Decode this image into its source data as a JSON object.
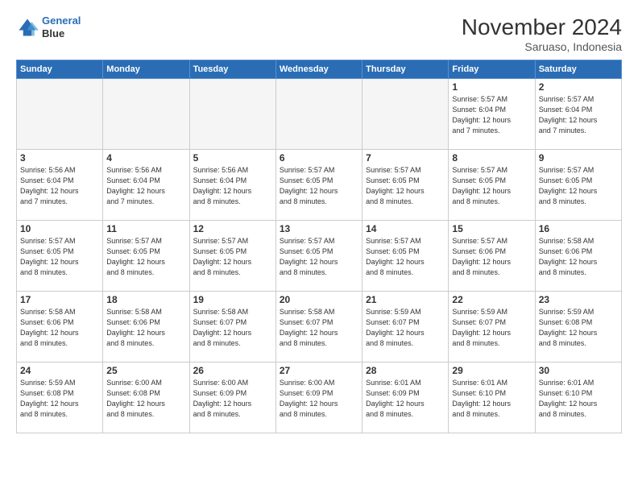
{
  "header": {
    "logo_line1": "General",
    "logo_line2": "Blue",
    "month": "November 2024",
    "location": "Saruaso, Indonesia"
  },
  "weekdays": [
    "Sunday",
    "Monday",
    "Tuesday",
    "Wednesday",
    "Thursday",
    "Friday",
    "Saturday"
  ],
  "weeks": [
    [
      {
        "day": "",
        "info": ""
      },
      {
        "day": "",
        "info": ""
      },
      {
        "day": "",
        "info": ""
      },
      {
        "day": "",
        "info": ""
      },
      {
        "day": "",
        "info": ""
      },
      {
        "day": "1",
        "info": "Sunrise: 5:57 AM\nSunset: 6:04 PM\nDaylight: 12 hours\nand 7 minutes."
      },
      {
        "day": "2",
        "info": "Sunrise: 5:57 AM\nSunset: 6:04 PM\nDaylight: 12 hours\nand 7 minutes."
      }
    ],
    [
      {
        "day": "3",
        "info": "Sunrise: 5:56 AM\nSunset: 6:04 PM\nDaylight: 12 hours\nand 7 minutes."
      },
      {
        "day": "4",
        "info": "Sunrise: 5:56 AM\nSunset: 6:04 PM\nDaylight: 12 hours\nand 7 minutes."
      },
      {
        "day": "5",
        "info": "Sunrise: 5:56 AM\nSunset: 6:04 PM\nDaylight: 12 hours\nand 8 minutes."
      },
      {
        "day": "6",
        "info": "Sunrise: 5:57 AM\nSunset: 6:05 PM\nDaylight: 12 hours\nand 8 minutes."
      },
      {
        "day": "7",
        "info": "Sunrise: 5:57 AM\nSunset: 6:05 PM\nDaylight: 12 hours\nand 8 minutes."
      },
      {
        "day": "8",
        "info": "Sunrise: 5:57 AM\nSunset: 6:05 PM\nDaylight: 12 hours\nand 8 minutes."
      },
      {
        "day": "9",
        "info": "Sunrise: 5:57 AM\nSunset: 6:05 PM\nDaylight: 12 hours\nand 8 minutes."
      }
    ],
    [
      {
        "day": "10",
        "info": "Sunrise: 5:57 AM\nSunset: 6:05 PM\nDaylight: 12 hours\nand 8 minutes."
      },
      {
        "day": "11",
        "info": "Sunrise: 5:57 AM\nSunset: 6:05 PM\nDaylight: 12 hours\nand 8 minutes."
      },
      {
        "day": "12",
        "info": "Sunrise: 5:57 AM\nSunset: 6:05 PM\nDaylight: 12 hours\nand 8 minutes."
      },
      {
        "day": "13",
        "info": "Sunrise: 5:57 AM\nSunset: 6:05 PM\nDaylight: 12 hours\nand 8 minutes."
      },
      {
        "day": "14",
        "info": "Sunrise: 5:57 AM\nSunset: 6:05 PM\nDaylight: 12 hours\nand 8 minutes."
      },
      {
        "day": "15",
        "info": "Sunrise: 5:57 AM\nSunset: 6:06 PM\nDaylight: 12 hours\nand 8 minutes."
      },
      {
        "day": "16",
        "info": "Sunrise: 5:58 AM\nSunset: 6:06 PM\nDaylight: 12 hours\nand 8 minutes."
      }
    ],
    [
      {
        "day": "17",
        "info": "Sunrise: 5:58 AM\nSunset: 6:06 PM\nDaylight: 12 hours\nand 8 minutes."
      },
      {
        "day": "18",
        "info": "Sunrise: 5:58 AM\nSunset: 6:06 PM\nDaylight: 12 hours\nand 8 minutes."
      },
      {
        "day": "19",
        "info": "Sunrise: 5:58 AM\nSunset: 6:07 PM\nDaylight: 12 hours\nand 8 minutes."
      },
      {
        "day": "20",
        "info": "Sunrise: 5:58 AM\nSunset: 6:07 PM\nDaylight: 12 hours\nand 8 minutes."
      },
      {
        "day": "21",
        "info": "Sunrise: 5:59 AM\nSunset: 6:07 PM\nDaylight: 12 hours\nand 8 minutes."
      },
      {
        "day": "22",
        "info": "Sunrise: 5:59 AM\nSunset: 6:07 PM\nDaylight: 12 hours\nand 8 minutes."
      },
      {
        "day": "23",
        "info": "Sunrise: 5:59 AM\nSunset: 6:08 PM\nDaylight: 12 hours\nand 8 minutes."
      }
    ],
    [
      {
        "day": "24",
        "info": "Sunrise: 5:59 AM\nSunset: 6:08 PM\nDaylight: 12 hours\nand 8 minutes."
      },
      {
        "day": "25",
        "info": "Sunrise: 6:00 AM\nSunset: 6:08 PM\nDaylight: 12 hours\nand 8 minutes."
      },
      {
        "day": "26",
        "info": "Sunrise: 6:00 AM\nSunset: 6:09 PM\nDaylight: 12 hours\nand 8 minutes."
      },
      {
        "day": "27",
        "info": "Sunrise: 6:00 AM\nSunset: 6:09 PM\nDaylight: 12 hours\nand 8 minutes."
      },
      {
        "day": "28",
        "info": "Sunrise: 6:01 AM\nSunset: 6:09 PM\nDaylight: 12 hours\nand 8 minutes."
      },
      {
        "day": "29",
        "info": "Sunrise: 6:01 AM\nSunset: 6:10 PM\nDaylight: 12 hours\nand 8 minutes."
      },
      {
        "day": "30",
        "info": "Sunrise: 6:01 AM\nSunset: 6:10 PM\nDaylight: 12 hours\nand 8 minutes."
      }
    ]
  ]
}
